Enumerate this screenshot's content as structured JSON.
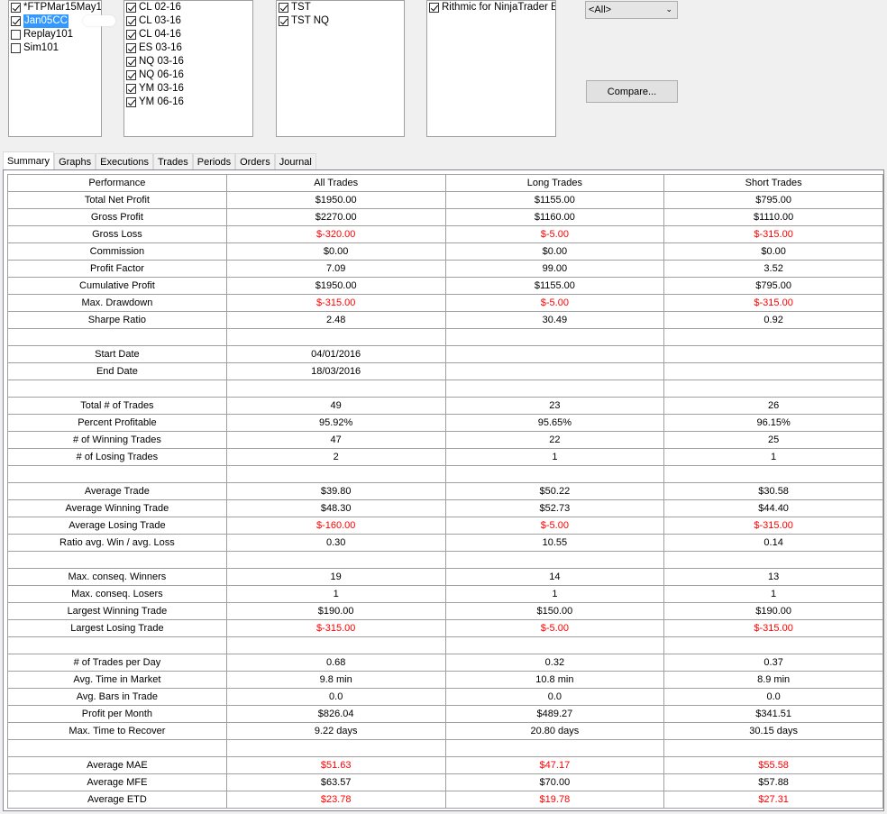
{
  "accounts": [
    {
      "label": "*FTPMar15May1",
      "checked": true,
      "selected": false
    },
    {
      "label": "Jan05CC",
      "checked": true,
      "selected": true
    },
    {
      "label": "Replay101",
      "checked": false,
      "selected": false
    },
    {
      "label": "Sim101",
      "checked": false,
      "selected": false
    }
  ],
  "instruments": [
    {
      "label": "CL 02-16",
      "checked": true
    },
    {
      "label": "CL 03-16",
      "checked": true
    },
    {
      "label": "CL 04-16",
      "checked": true
    },
    {
      "label": "ES 03-16",
      "checked": true
    },
    {
      "label": "NQ 03-16",
      "checked": true
    },
    {
      "label": "NQ 06-16",
      "checked": true
    },
    {
      "label": "YM 03-16",
      "checked": true
    },
    {
      "label": "YM 06-16",
      "checked": true
    }
  ],
  "strategies": [
    {
      "label": "TST",
      "checked": true
    },
    {
      "label": "TST NQ",
      "checked": true
    }
  ],
  "connections": [
    {
      "label": "Rithmic for NinjaTrader E",
      "checked": true
    }
  ],
  "filter_select": {
    "value": "<All>"
  },
  "compare_button": {
    "label": "Compare..."
  },
  "tabs": [
    {
      "label": "Summary",
      "active": true
    },
    {
      "label": "Graphs",
      "active": false
    },
    {
      "label": "Executions",
      "active": false
    },
    {
      "label": "Trades",
      "active": false
    },
    {
      "label": "Periods",
      "active": false
    },
    {
      "label": "Orders",
      "active": false
    },
    {
      "label": "Journal",
      "active": false
    }
  ],
  "colors": {
    "negative": "#ff0000",
    "selection": "#3399ff"
  },
  "summary": {
    "headers": [
      "Performance",
      "All Trades",
      "Long Trades",
      "Short Trades"
    ],
    "rows": [
      [
        "Total Net Profit",
        "$1950.00",
        "$1155.00",
        "$795.00"
      ],
      [
        "Gross Profit",
        "$2270.00",
        "$1160.00",
        "$1110.00"
      ],
      [
        "Gross Loss",
        "$-320.00",
        "$-5.00",
        "$-315.00"
      ],
      [
        "Commission",
        "$0.00",
        "$0.00",
        "$0.00"
      ],
      [
        "Profit Factor",
        "7.09",
        "99.00",
        "3.52"
      ],
      [
        "Cumulative Profit",
        "$1950.00",
        "$1155.00",
        "$795.00"
      ],
      [
        "Max. Drawdown",
        "$-315.00",
        "$-5.00",
        "$-315.00"
      ],
      [
        "Sharpe Ratio",
        "2.48",
        "30.49",
        "0.92"
      ],
      [
        "",
        "",
        "",
        ""
      ],
      [
        "Start Date",
        "04/01/2016",
        "",
        ""
      ],
      [
        "End Date",
        "18/03/2016",
        "",
        ""
      ],
      [
        "",
        "",
        "",
        ""
      ],
      [
        "Total # of Trades",
        "49",
        "23",
        "26"
      ],
      [
        "Percent Profitable",
        "95.92%",
        "95.65%",
        "96.15%"
      ],
      [
        "# of Winning Trades",
        "47",
        "22",
        "25"
      ],
      [
        "# of Losing Trades",
        "2",
        "1",
        "1"
      ],
      [
        "",
        "",
        "",
        ""
      ],
      [
        "Average Trade",
        "$39.80",
        "$50.22",
        "$30.58"
      ],
      [
        "Average Winning Trade",
        "$48.30",
        "$52.73",
        "$44.40"
      ],
      [
        "Average Losing Trade",
        "$-160.00",
        "$-5.00",
        "$-315.00"
      ],
      [
        "Ratio avg. Win / avg. Loss",
        "0.30",
        "10.55",
        "0.14"
      ],
      [
        "",
        "",
        "",
        ""
      ],
      [
        "Max. conseq. Winners",
        "19",
        "14",
        "13"
      ],
      [
        "Max. conseq. Losers",
        "1",
        "1",
        "1"
      ],
      [
        "Largest Winning Trade",
        "$190.00",
        "$150.00",
        "$190.00"
      ],
      [
        "Largest Losing Trade",
        "$-315.00",
        "$-5.00",
        "$-315.00"
      ],
      [
        "",
        "",
        "",
        ""
      ],
      [
        "# of Trades per Day",
        "0.68",
        "0.32",
        "0.37"
      ],
      [
        "Avg. Time in Market",
        "9.8 min",
        "10.8 min",
        "8.9 min"
      ],
      [
        "Avg. Bars in Trade",
        "0.0",
        "0.0",
        "0.0"
      ],
      [
        "Profit per Month",
        "$826.04",
        "$489.27",
        "$341.51"
      ],
      [
        "Max. Time to Recover",
        "9.22 days",
        "20.80 days",
        "30.15 days"
      ],
      [
        "",
        "",
        "",
        ""
      ],
      [
        "Average MAE",
        "$51.63",
        "$47.17",
        "$55.58"
      ],
      [
        "Average MFE",
        "$63.57",
        "$70.00",
        "$57.88"
      ],
      [
        "Average ETD",
        "$23.78",
        "$19.78",
        "$27.31"
      ]
    ],
    "negative_rows": [
      "Gross Loss",
      "Max. Drawdown",
      "Average Losing Trade",
      "Largest Losing Trade",
      "Average MAE",
      "Average ETD"
    ]
  }
}
